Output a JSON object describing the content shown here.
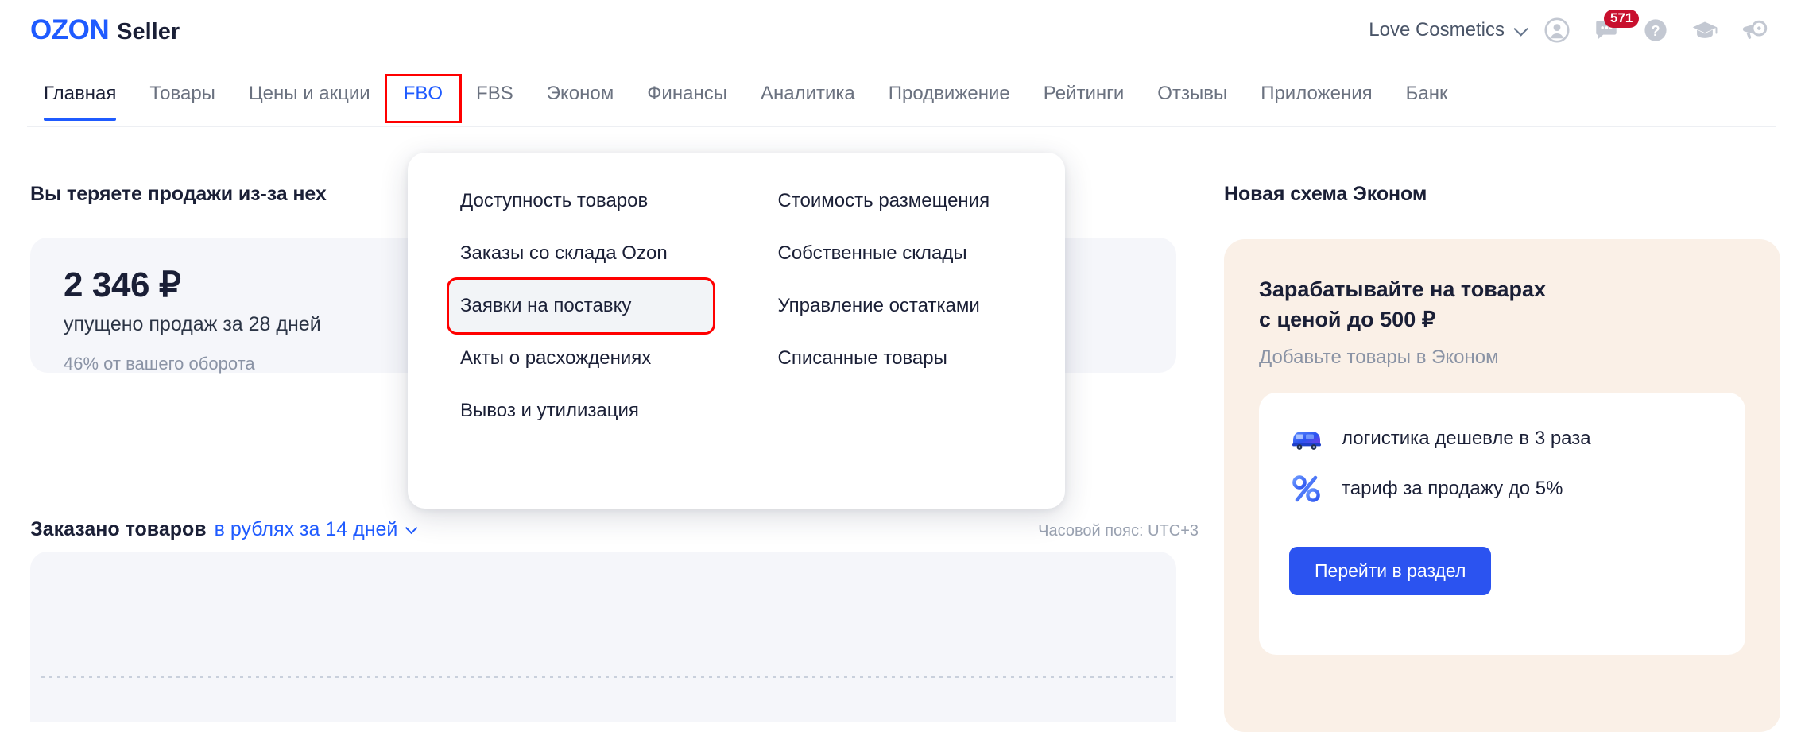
{
  "header": {
    "logo_primary": "OZON",
    "logo_secondary": "Seller",
    "account": "Love Cosmetics",
    "icons": [
      {
        "name": "user-icon",
        "glyph": "person"
      },
      {
        "name": "chat-icon",
        "glyph": "chat",
        "badge": "571"
      },
      {
        "name": "help-icon",
        "glyph": "question"
      },
      {
        "name": "education-icon",
        "glyph": "graduation-cap"
      },
      {
        "name": "announcements-icon",
        "glyph": "megaphone"
      }
    ]
  },
  "nav": {
    "tabs": [
      {
        "label": "Главная",
        "state": "active"
      },
      {
        "label": "Товары",
        "state": "normal"
      },
      {
        "label": "Цены и акции",
        "state": "normal"
      },
      {
        "label": "FBO",
        "state": "current-highlight"
      },
      {
        "label": "FBS",
        "state": "normal"
      },
      {
        "label": "Эконом",
        "state": "normal"
      },
      {
        "label": "Финансы",
        "state": "normal"
      },
      {
        "label": "Аналитика",
        "state": "normal"
      },
      {
        "label": "Продвижение",
        "state": "normal"
      },
      {
        "label": "Рейтинги",
        "state": "normal"
      },
      {
        "label": "Отзывы",
        "state": "normal"
      },
      {
        "label": "Приложения",
        "state": "normal"
      },
      {
        "label": "Банк",
        "state": "normal"
      }
    ]
  },
  "dropdown": {
    "left_items": [
      {
        "label": "Доступность товаров",
        "selected": false
      },
      {
        "label": "Заказы со склада Ozon",
        "selected": false
      },
      {
        "label": "Заявки на поставку",
        "selected": true
      },
      {
        "label": "Акты о расхождениях",
        "selected": false
      },
      {
        "label": "Вывоз и утилизация",
        "selected": false
      }
    ],
    "right_items": [
      {
        "label": "Стоимость размещения",
        "selected": false
      },
      {
        "label": "Собственные склады",
        "selected": false
      },
      {
        "label": "Управление остатками",
        "selected": false
      },
      {
        "label": "Списанные товары",
        "selected": false
      }
    ]
  },
  "main": {
    "loss_heading": "Вы теряете продажи из-за нех",
    "loss_amount": "2 346 ₽",
    "loss_subtitle": "упущено продаж за 28 дней",
    "loss_note": "46% от вашего оборота",
    "ordered_title": "Заказано товаров",
    "ordered_filter": "в рублях за 14 дней",
    "timezone": "Часовой пояс: UTC+3"
  },
  "promo": {
    "heading": "Новая схема Эконом",
    "title_line1": "Зарабатывайте на товарах",
    "title_line2": "с ценой до 500 ₽",
    "subtitle": "Добавьте товары в Эконом",
    "features": [
      {
        "icon": "truck-icon",
        "text": "логистика дешевле в 3 раза"
      },
      {
        "icon": "percent-icon",
        "text": "тариф за продажу до 5%"
      }
    ],
    "cta_label": "Перейти в раздел"
  },
  "colors": {
    "brand_blue": "#1F5BFF",
    "cta_blue": "#2B53F0",
    "badge_red": "#C8102E",
    "highlight_red": "#FF0000",
    "card_gray": "#F5F6FA",
    "promo_beige": "#FAF0E7",
    "text_dark": "#1A1F36",
    "text_muted": "#8A93A5"
  },
  "chart_data": {
    "type": "line",
    "title": "Заказано товаров",
    "subtitle": "в рублях за 14 дней",
    "categories": [],
    "values": [],
    "xlabel": "",
    "ylabel": "",
    "grid": true,
    "note": "Empty chart placeholder with single dotted baseline"
  }
}
